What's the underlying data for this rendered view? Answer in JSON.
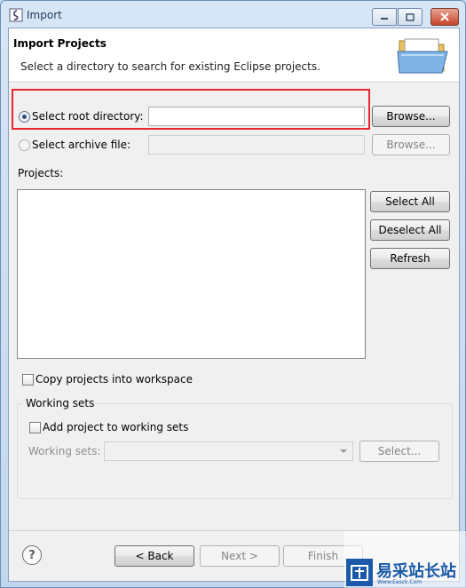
{
  "window": {
    "title": "Import"
  },
  "banner": {
    "title": "Import Projects",
    "description": "Select a directory to search for existing Eclipse projects."
  },
  "source": {
    "root_radio_label": "Select root directory:",
    "root_radio_checked": true,
    "root_value": "",
    "root_browse": "Browse...",
    "archive_radio_label": "Select archive file:",
    "archive_value": "",
    "archive_browse": "Browse..."
  },
  "projects": {
    "label": "Projects:",
    "items": [],
    "select_all": "Select All",
    "deselect_all": "Deselect All",
    "refresh": "Refresh"
  },
  "options": {
    "copy_label": "Copy projects into workspace",
    "copy_checked": false
  },
  "working_sets": {
    "group_title": "Working sets",
    "add_label": "Add project to working sets",
    "add_checked": false,
    "sets_label": "Working sets:",
    "sets_value": "",
    "select_button": "Select..."
  },
  "footer": {
    "back": "< Back",
    "next": "Next >",
    "finish": "Finish"
  },
  "watermark": {
    "text": "易采站长站",
    "sub": "Www.Easck.Com"
  },
  "colors": {
    "highlight": "#e8262f",
    "title_text": "#1e395b",
    "watermark": "#1a5aa8"
  }
}
